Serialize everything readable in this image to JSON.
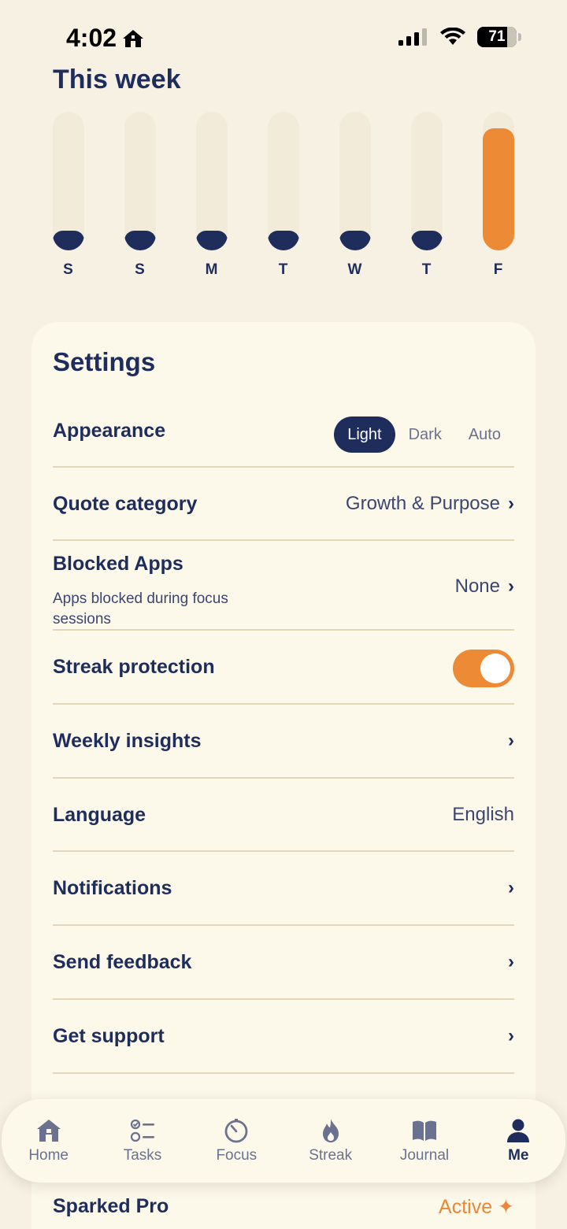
{
  "status_bar": {
    "time": "4:02",
    "battery": "71"
  },
  "week": {
    "title": "This week",
    "days": [
      {
        "label": "S",
        "level": 0.14,
        "color": "#1f2d5c"
      },
      {
        "label": "S",
        "level": 0.14,
        "color": "#1f2d5c"
      },
      {
        "label": "M",
        "level": 0.14,
        "color": "#1f2d5c"
      },
      {
        "label": "T",
        "level": 0.14,
        "color": "#1f2d5c"
      },
      {
        "label": "W",
        "level": 0.14,
        "color": "#1f2d5c"
      },
      {
        "label": "T",
        "level": 0.14,
        "color": "#1f2d5c"
      },
      {
        "label": "F",
        "level": 0.88,
        "color": "#ec8a36"
      }
    ]
  },
  "settings": {
    "title": "Settings",
    "appearance": {
      "label": "Appearance",
      "options": [
        "Light",
        "Dark",
        "Auto"
      ],
      "selected": "Light"
    },
    "quote_category": {
      "label": "Quote category",
      "value": "Growth & Purpose"
    },
    "blocked_apps": {
      "label": "Blocked Apps",
      "sub": "Apps blocked during focus sessions",
      "value": "None"
    },
    "streak_protection": {
      "label": "Streak protection",
      "enabled": true
    },
    "weekly_insights": {
      "label": "Weekly insights"
    },
    "language": {
      "label": "Language",
      "value": "English"
    },
    "notifications": {
      "label": "Notifications"
    },
    "send_feedback": {
      "label": "Send feedback"
    },
    "get_support": {
      "label": "Get support"
    },
    "pro": {
      "label": "Sparked Pro",
      "value": "Active ✦"
    }
  },
  "chevron": "›",
  "tabs": [
    {
      "label": "Home",
      "icon": "home-icon"
    },
    {
      "label": "Tasks",
      "icon": "tasks-icon"
    },
    {
      "label": "Focus",
      "icon": "timer-icon"
    },
    {
      "label": "Streak",
      "icon": "flame-icon"
    },
    {
      "label": "Journal",
      "icon": "book-icon"
    },
    {
      "label": "Me",
      "icon": "person-icon",
      "active": true
    }
  ],
  "colors": {
    "navy": "#1f2d5c",
    "accent": "#ec8a36",
    "background": "#f7f1e3",
    "card": "#fcf8ea"
  }
}
